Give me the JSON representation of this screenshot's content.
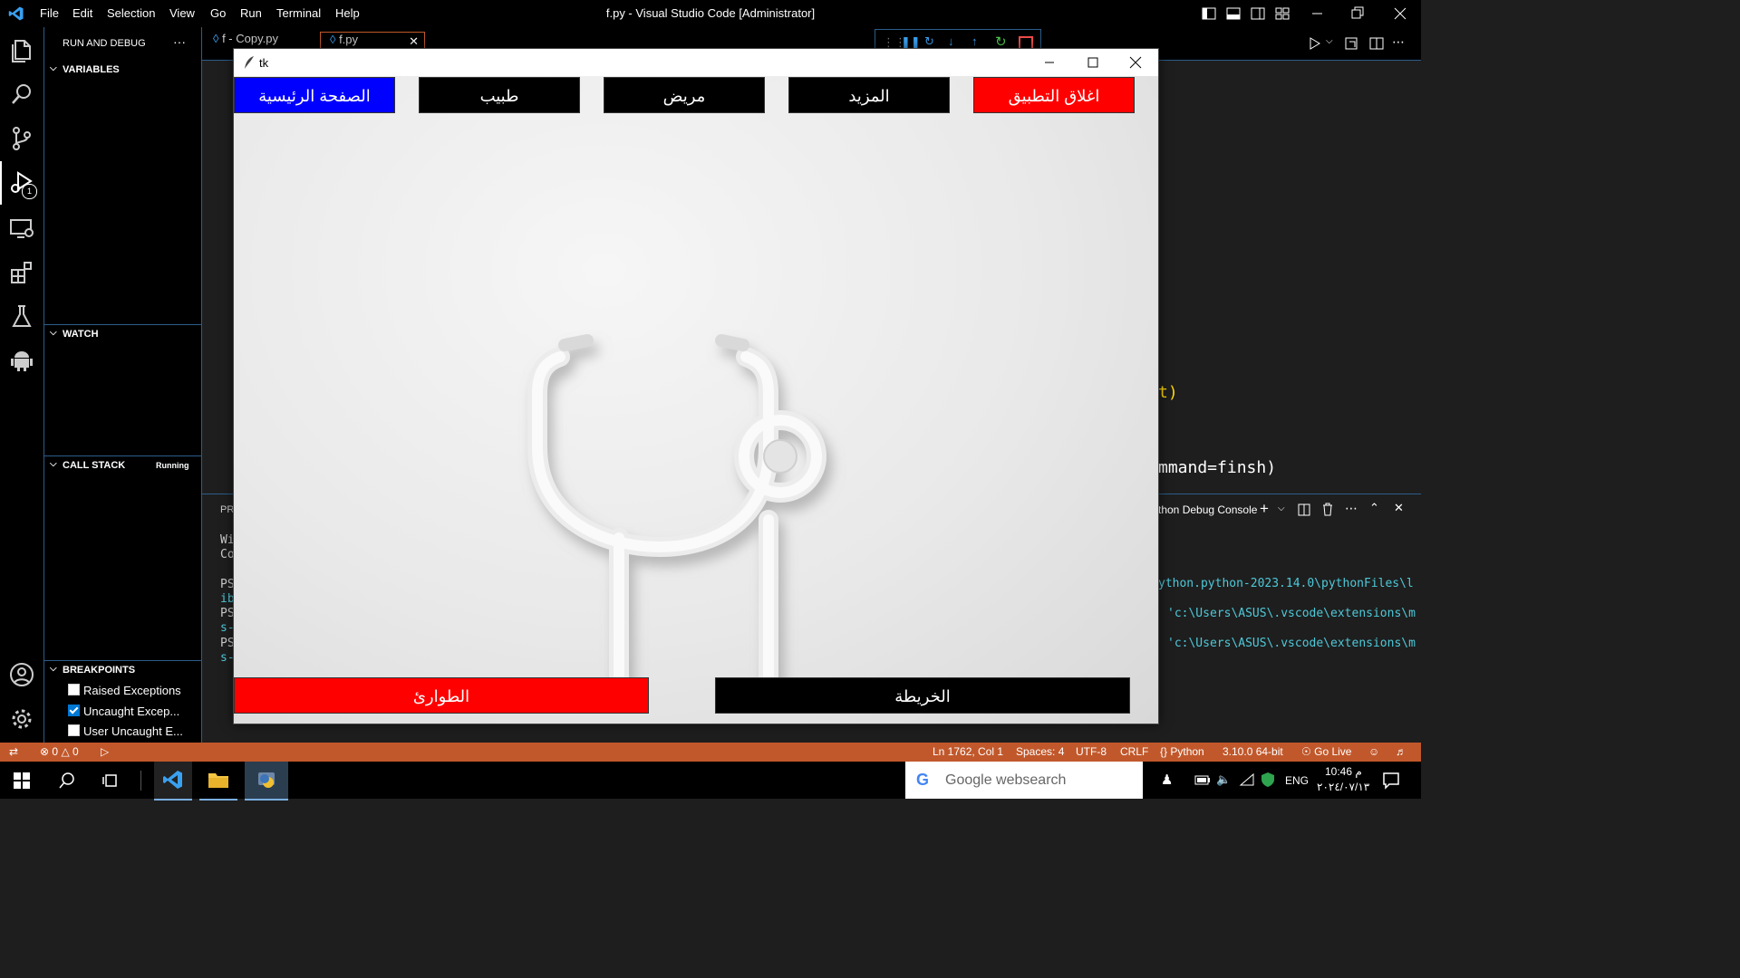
{
  "vscode": {
    "window_title": "f.py - Visual Studio Code [Administrator]",
    "menu": [
      "File",
      "Edit",
      "Selection",
      "View",
      "Go",
      "Run",
      "Terminal",
      "Help"
    ],
    "activity_badge": "1",
    "sidebar": {
      "title": "RUN AND DEBUG",
      "more": "···",
      "variables": "VARIABLES",
      "watch": "WATCH",
      "call_stack": "CALL STACK",
      "call_stack_status": "Running",
      "breakpoints": "BREAKPOINTS",
      "breakpoint_items": [
        {
          "label": "Raised Exceptions",
          "checked": false
        },
        {
          "label": "Uncaught Excep...",
          "checked": true
        },
        {
          "label": "User Uncaught E...",
          "checked": false
        }
      ]
    },
    "tabs": [
      {
        "label": "f - Copy.py"
      },
      {
        "label": "f.py"
      }
    ],
    "code_fragments": [
      "t)",
      "mmand=finsh)"
    ],
    "panel": {
      "label_left": "PR",
      "console_title": "thon Debug Console",
      "left_fragments": [
        "Wi",
        "Co",
        "PS",
        "ib",
        "PS",
        "s-",
        "PS",
        "s-"
      ],
      "lines": [
        "ython.python-2023.14.0\\pythonFiles\\l",
        "'c:\\Users\\ASUS\\.vscode\\extensions\\m",
        "'c:\\Users\\ASUS\\.vscode\\extensions\\m"
      ]
    },
    "status": {
      "errors": "0",
      "warnings": "0",
      "position": "Ln 1762, Col 1",
      "spaces": "Spaces: 4",
      "encoding": "UTF-8",
      "eol": "CRLF",
      "language": "Python",
      "interpreter": "3.10.0 64-bit",
      "golive": "Go Live"
    }
  },
  "tk": {
    "title": "tk",
    "top_buttons": [
      {
        "label": "الصفحة الرئيسية",
        "bg": "#0000ff"
      },
      {
        "label": "طبيب",
        "bg": "#000000"
      },
      {
        "label": "مريض",
        "bg": "#000000"
      },
      {
        "label": "المزيد",
        "bg": "#000000"
      },
      {
        "label": "اغلاق التطبيق",
        "bg": "#ff0000"
      }
    ],
    "bottom_buttons": [
      {
        "label": "الطوارئ",
        "bg": "#ff0000"
      },
      {
        "label": "الخريطة",
        "bg": "#000000"
      }
    ],
    "image": "stethoscope"
  },
  "taskbar": {
    "search_placeholder": "Google websearch",
    "lang": "ENG",
    "time": "10:46 م",
    "date": "٢٠٢٤/٠٧/١٣"
  },
  "colors": {
    "accent": "#2b5d8a",
    "statusbar": "#c1582b",
    "tk_blue": "#0000ff",
    "tk_red": "#ff0000"
  }
}
